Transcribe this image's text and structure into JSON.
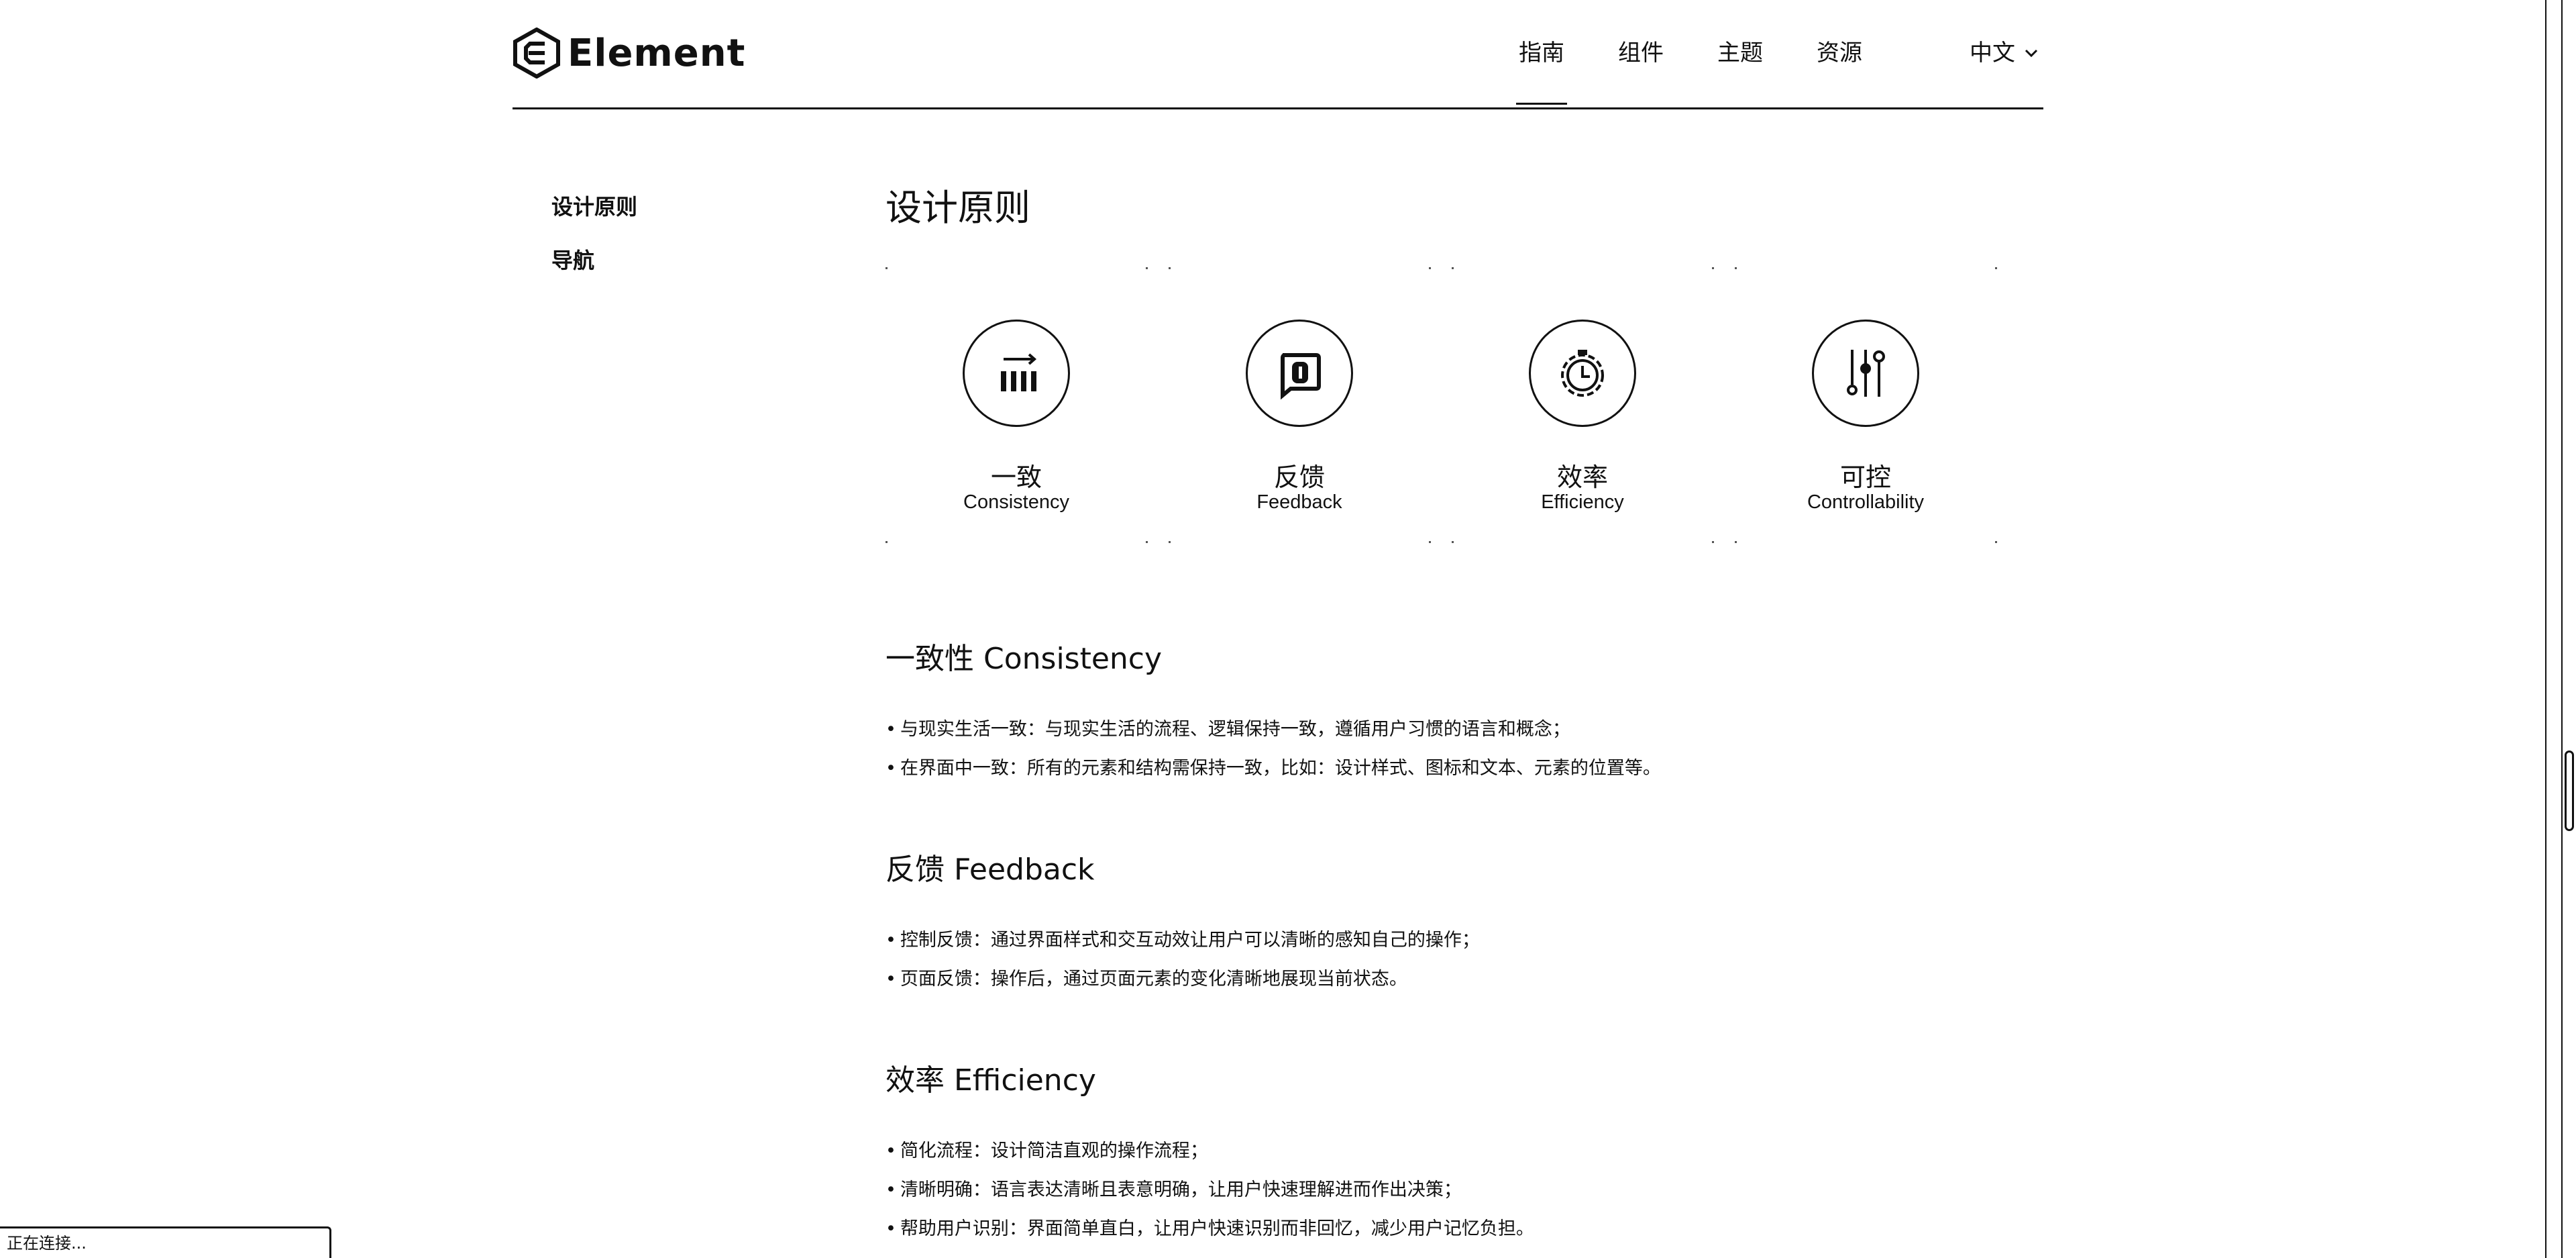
{
  "header": {
    "logo_text": "Element",
    "nav": [
      {
        "label": "指南",
        "active": true
      },
      {
        "label": "组件"
      },
      {
        "label": "主题"
      },
      {
        "label": "资源"
      }
    ],
    "language": "中文"
  },
  "sidebar": {
    "items": [
      {
        "label": "设计原则"
      },
      {
        "label": "导航"
      }
    ]
  },
  "main": {
    "title": "设计原则",
    "cards": [
      {
        "cn": "一致",
        "en": "Consistency",
        "icon": "consistency-icon"
      },
      {
        "cn": "反馈",
        "en": "Feedback",
        "icon": "feedback-icon"
      },
      {
        "cn": "效率",
        "en": "Efficiency",
        "icon": "efficiency-icon"
      },
      {
        "cn": "可控",
        "en": "Controllability",
        "icon": "controllability-icon"
      }
    ],
    "sections": [
      {
        "title": "一致性 Consistency",
        "items": [
          "与现实生活一致：与现实生活的流程、逻辑保持一致，遵循用户习惯的语言和概念；",
          "在界面中一致：所有的元素和结构需保持一致，比如：设计样式、图标和文本、元素的位置等。"
        ]
      },
      {
        "title": "反馈 Feedback",
        "items": [
          "控制反馈：通过界面样式和交互动效让用户可以清晰的感知自己的操作；",
          "页面反馈：操作后，通过页面元素的变化清晰地展现当前状态。"
        ]
      },
      {
        "title": "效率 Efficiency",
        "items": [
          "简化流程：设计简洁直观的操作流程；",
          "清晰明确：语言表达清晰且表意明确，让用户快速理解进而作出决策；",
          "帮助用户识别：界面简单直白，让用户快速识别而非回忆，减少用户记忆负担。"
        ]
      }
    ]
  },
  "status_bar": {
    "text": "正在连接..."
  }
}
